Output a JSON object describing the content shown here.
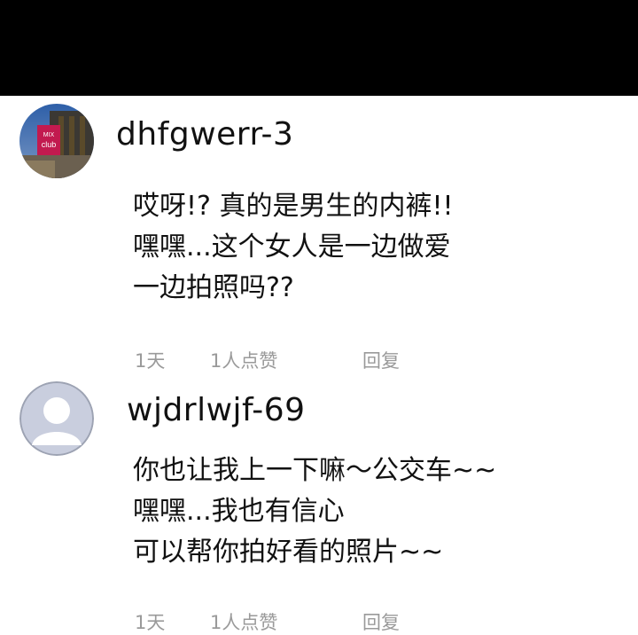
{
  "comments": [
    {
      "username": "dhfgwerr-3",
      "avatar_sign": {
        "line1": "MIX",
        "line2": "club"
      },
      "lines": [
        "哎呀!? 真的是男生的内裤!!",
        "嘿嘿...这个女人是一边做爱",
        "一边拍照吗??"
      ],
      "time": "1天",
      "likes": "1人点赞",
      "reply_label": "回复"
    },
    {
      "username": "wjdrlwjf-69",
      "avatar_sign": null,
      "lines": [
        "你也让我上一下嘛～公交车~~",
        "嘿嘿...我也有信心",
        "可以帮你拍好看的照片~~"
      ],
      "time": "1天",
      "likes": "1人点赞",
      "reply_label": "回复"
    }
  ],
  "colors": {
    "top_bar": "#000000",
    "meta_text": "#9a9a9a",
    "default_avatar_bg": "#c9cede",
    "default_avatar_fg": "#ffffff"
  }
}
